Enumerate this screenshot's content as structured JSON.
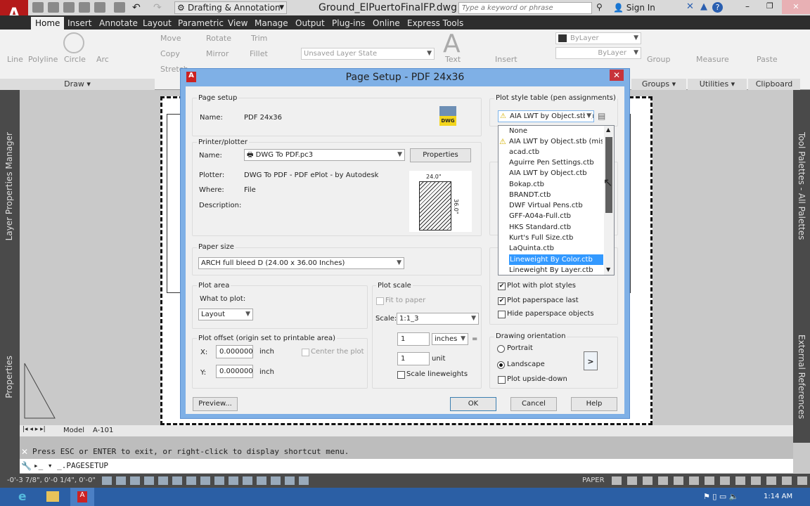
{
  "app": {
    "logo": "A",
    "workspace": "Drafting & Annotation",
    "doc_title": "Ground_ElPuertoFinalFP.dwg",
    "search_placeholder": "Type a keyword or phrase",
    "sign_in": "Sign In"
  },
  "tabs": [
    "Home",
    "Insert",
    "Annotate",
    "Layout",
    "Parametric",
    "View",
    "Manage",
    "Output",
    "Plug-ins",
    "Online",
    "Express Tools"
  ],
  "ribbon": {
    "draw": [
      "Line",
      "Polyline",
      "Circle",
      "Arc"
    ],
    "modify": [
      "Move",
      "Rotate",
      "Trim",
      "Copy",
      "Mirror",
      "Fillet",
      "Stretch"
    ],
    "layer_state": "Unsaved Layer State",
    "annotation": [
      "Text"
    ],
    "block": [
      "Insert"
    ],
    "properties": [
      "ByLayer",
      "ByLayer"
    ],
    "group": "Group",
    "measure": "Measure",
    "paste": "Paste",
    "panels": [
      "Draw",
      "Groups",
      "Utilities",
      "Clipboard"
    ]
  },
  "side": {
    "left_top": "Layer Properties Manager",
    "left_bottom": "Properties",
    "right_top": "Tool Palettes - All Palettes",
    "right_bottom": "External References"
  },
  "layout_tabs": [
    "Model",
    "A-101"
  ],
  "command": {
    "message": "Press ESC or ENTER to exit, or right-click to display shortcut menu.",
    "input": "_.PAGESETUP"
  },
  "status": {
    "coords": "-0'-3 7/8\", 0'-0 1/4\", 0'-0\"",
    "space": "PAPER"
  },
  "taskbar": {
    "time": "1:14 AM"
  },
  "dialog": {
    "title": "Page Setup - PDF 24x36",
    "page_setup": {
      "heading": "Page setup",
      "name_label": "Name:",
      "name": "PDF 24x36",
      "icon_text": "DWG"
    },
    "printer": {
      "heading": "Printer/plotter",
      "name_label": "Name:",
      "name": "DWG To PDF.pc3",
      "properties": "Properties",
      "plotter_label": "Plotter:",
      "plotter": "DWG To PDF - PDF ePlot - by Autodesk",
      "where_label": "Where:",
      "where": "File",
      "description_label": "Description:",
      "width_dim": "24.0\"",
      "height_dim": "36.0\""
    },
    "paper_size": {
      "heading": "Paper size",
      "value": "ARCH full bleed D (24.00 x 36.00 Inches)"
    },
    "plot_area": {
      "heading": "Plot area",
      "what_label": "What to plot:",
      "value": "Layout"
    },
    "plot_offset": {
      "heading": "Plot offset (origin set to printable area)",
      "x_label": "X:",
      "x": "0.000000",
      "y_label": "Y:",
      "y": "0.000000",
      "unit": "inch",
      "center": "Center the plot"
    },
    "plot_scale": {
      "heading": "Plot scale",
      "fit": "Fit to paper",
      "scale_label": "Scale:",
      "scale": "1:1_3",
      "inches_value": "1",
      "inches_unit": "inches",
      "equals": "=",
      "unit_value": "1",
      "unit_label": "unit",
      "scale_lw": "Scale lineweights"
    },
    "plot_style": {
      "heading": "Plot style table (pen assignments)",
      "value": "AIA LWT by Object.stb (missing)",
      "options": [
        "None",
        "AIA LWT by Object.stb (missing)",
        "acad.ctb",
        "Aguirre Pen Settings.ctb",
        "AIA LWT by Object.ctb",
        "Bokap.ctb",
        "BRANDT.ctb",
        "DWF Virtual Pens.ctb",
        "GFF-A04a-Full.ctb",
        "HKS Standard.ctb",
        "Kurt's Full Size.ctb",
        "LaQuinta.ctb",
        "Lineweight By Color.ctb",
        "Lineweight By Layer.ctb"
      ],
      "highlighted": "Lineweight By Color.ctb"
    },
    "plot_options": {
      "plot_with_styles": "Plot with plot styles",
      "plot_with_styles_checked": true,
      "paperspace_last": "Plot paperspace last",
      "paperspace_last_checked": true,
      "hide_paperspace": "Hide paperspace objects",
      "hide_paperspace_checked": false
    },
    "orientation": {
      "heading": "Drawing orientation",
      "portrait": "Portrait",
      "landscape": "Landscape",
      "selected": "Landscape",
      "upside_down": "Plot upside-down"
    },
    "buttons": {
      "preview": "Preview...",
      "ok": "OK",
      "cancel": "Cancel",
      "help": "Help"
    }
  },
  "colors": {
    "dialog_title": "#7fb0e6",
    "selection": "#3399ff",
    "close": "#c7333b",
    "app_red": "#b41a1a"
  }
}
